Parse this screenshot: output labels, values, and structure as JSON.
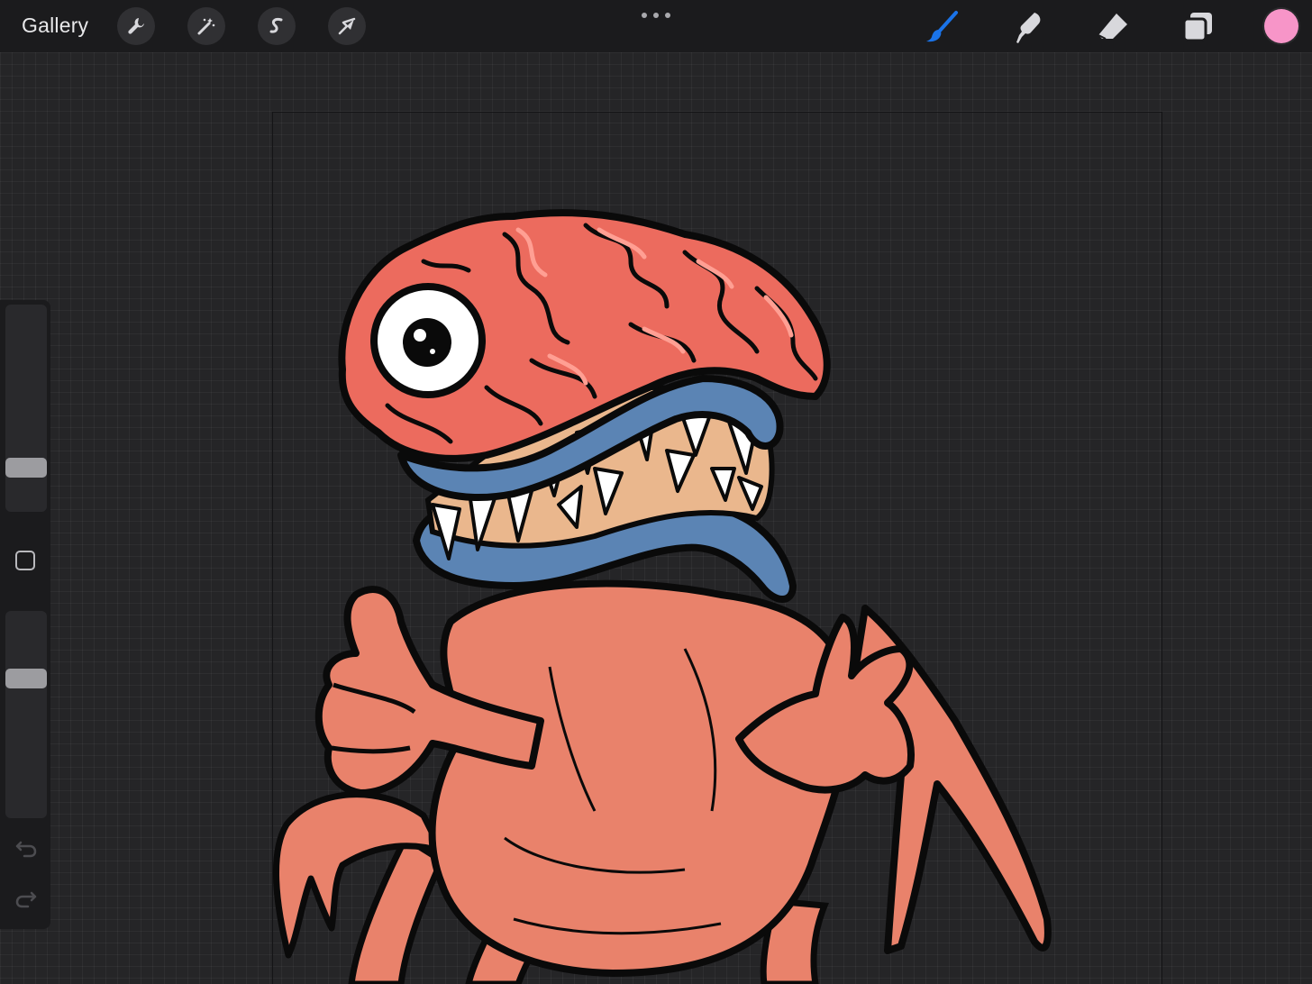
{
  "topbar": {
    "gallery_label": "Gallery",
    "left_tools": [
      {
        "name": "actions",
        "icon": "wrench-icon"
      },
      {
        "name": "adjustments",
        "icon": "magic-wand-icon"
      },
      {
        "name": "selection",
        "icon": "selection-s-icon"
      },
      {
        "name": "transform",
        "icon": "arrow-cursor-icon"
      }
    ],
    "more_icon": "more-dots-icon",
    "right_tools": [
      {
        "name": "brush",
        "icon": "brush-icon",
        "active": true
      },
      {
        "name": "smudge",
        "icon": "smudge-finger-icon",
        "active": false
      },
      {
        "name": "eraser",
        "icon": "eraser-icon",
        "active": false
      },
      {
        "name": "layers",
        "icon": "layers-icon",
        "active": false
      }
    ],
    "current_color": "#f795c8",
    "active_color": "#1a73e8"
  },
  "sidebar": {
    "brush_size_level": 0.22,
    "opacity_level": 0.35,
    "modify_icon": "square-outline-icon",
    "undo_icon": "undo-arrow-icon",
    "redo_icon": "redo-arrow-icon"
  },
  "artwork": {
    "subject": "brain-monster-illustration",
    "colors": {
      "brain": "#ec6b5e",
      "brain_highlight": "#ff9f93",
      "lips": "#5b84b4",
      "gums": "#eab78d",
      "body": "#e9826b",
      "outline": "#0a0a0a"
    }
  }
}
